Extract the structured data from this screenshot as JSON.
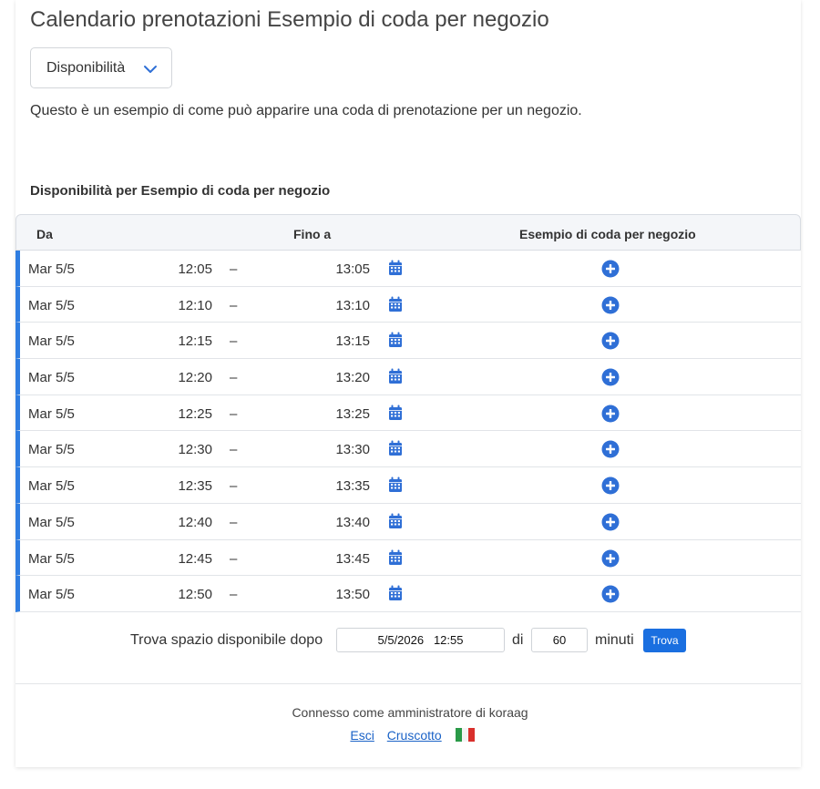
{
  "title": "Calendario prenotazioni Esempio di coda per negozio",
  "view_select": {
    "value": "Disponibilità",
    "icon": "chevron-down-icon"
  },
  "description": "Questo è un esempio di come può apparire una coda di prenotazione per un negozio.",
  "section_title": "Disponibilità per Esempio di coda per negozio",
  "table": {
    "headers": {
      "from": "Da",
      "to": "Fino a",
      "resource": "Esempio di coda per negozio"
    },
    "rows": [
      {
        "day": "Mar 5/5",
        "start": "12:05",
        "sep": "–",
        "end": "13:05"
      },
      {
        "day": "Mar 5/5",
        "start": "12:10",
        "sep": "–",
        "end": "13:10"
      },
      {
        "day": "Mar 5/5",
        "start": "12:15",
        "sep": "–",
        "end": "13:15"
      },
      {
        "day": "Mar 5/5",
        "start": "12:20",
        "sep": "–",
        "end": "13:20"
      },
      {
        "day": "Mar 5/5",
        "start": "12:25",
        "sep": "–",
        "end": "13:25"
      },
      {
        "day": "Mar 5/5",
        "start": "12:30",
        "sep": "–",
        "end": "13:30"
      },
      {
        "day": "Mar 5/5",
        "start": "12:35",
        "sep": "–",
        "end": "13:35"
      },
      {
        "day": "Mar 5/5",
        "start": "12:40",
        "sep": "–",
        "end": "13:40"
      },
      {
        "day": "Mar 5/5",
        "start": "12:45",
        "sep": "–",
        "end": "13:45"
      },
      {
        "day": "Mar 5/5",
        "start": "12:50",
        "sep": "–",
        "end": "13:50"
      }
    ]
  },
  "finder": {
    "label": "Trova spazio disponibile dopo",
    "datetime_value": "5/5/2026   12:55",
    "di": "di",
    "minutes_value": "60",
    "minutes_label": "minuti",
    "button": "Trova"
  },
  "footer": {
    "status": "Connesso come amministratore di koraag",
    "logout": "Esci",
    "dashboard": "Cruscotto",
    "flag": "italian-flag-icon"
  },
  "colors": {
    "accent": "#2f7de1",
    "button": "#1a6fe0",
    "link": "#1a62c7"
  }
}
